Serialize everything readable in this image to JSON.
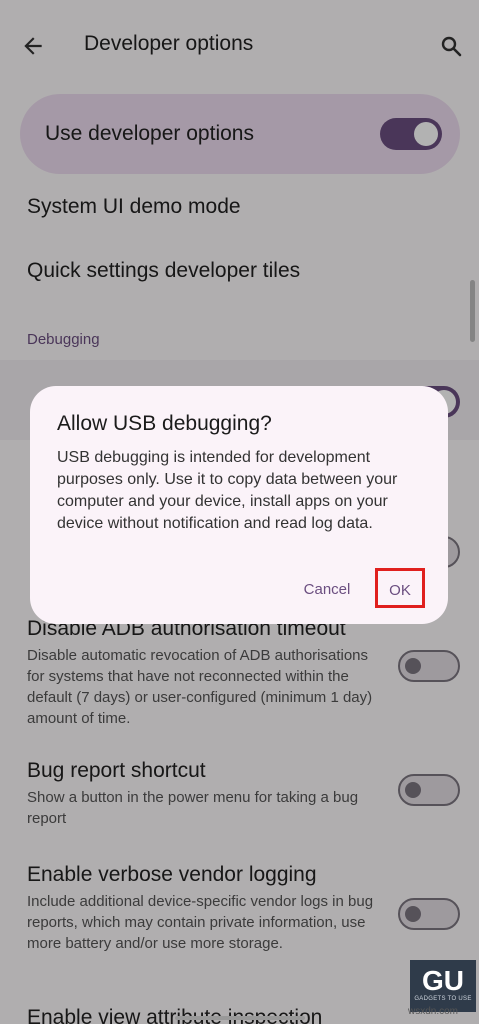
{
  "header": {
    "title": "Developer options",
    "back_icon": "arrow-back-icon",
    "search_icon": "search-icon"
  },
  "master_switch": {
    "label": "Use developer options",
    "state": "on"
  },
  "rows": [
    {
      "title": "System UI demo mode"
    },
    {
      "title": "Quick settings developer tiles"
    }
  ],
  "section": {
    "label": "Debugging"
  },
  "settings": [
    {
      "title": "Disable ADB authorisation timeout",
      "summary": "Disable automatic revocation of ADB authorisations for systems that have not reconnected within the default (7 days) or user-configured (minimum 1 day) amount of time.",
      "state": "off"
    },
    {
      "title": "Bug report shortcut",
      "summary": "Show a button in the power menu for taking a bug report",
      "state": "off"
    },
    {
      "title": "Enable verbose vendor logging",
      "summary": "Include additional device-specific vendor logs in bug reports, which may contain private information, use more battery and/or use more storage.",
      "state": "off"
    },
    {
      "title": "Enable view attribute inspection"
    }
  ],
  "dialog": {
    "title": "Allow USB debugging?",
    "body": "USB debugging is intended for development purposes only. Use it to copy data between your computer and your device, install apps on your device without notification and read log data.",
    "cancel_label": "Cancel",
    "ok_label": "OK"
  },
  "watermark": {
    "logo_text": "GU",
    "tagline": "GADGETS TO USE",
    "site": "wsxdn.com"
  },
  "colors": {
    "accent": "#6b4e80",
    "highlight": "#e0201e",
    "card": "#ecdcef",
    "dialog": "#fbf3f9"
  }
}
